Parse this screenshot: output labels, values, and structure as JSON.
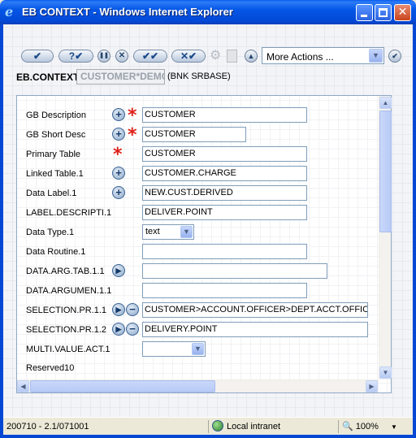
{
  "window": {
    "title": "EB CONTEXT - Windows Internet Explorer",
    "app_icon": "ie-e-icon"
  },
  "toolbar": {
    "buttons": [
      {
        "name": "commit-button",
        "glyph": "✔"
      },
      {
        "name": "validate-button",
        "glyph": "?✔"
      },
      {
        "name": "hold-button",
        "glyph": "❚❚"
      },
      {
        "name": "delete-button",
        "glyph": "✕"
      },
      {
        "name": "authorise-button",
        "glyph": "✔✔"
      },
      {
        "name": "reverse-button",
        "glyph": "✕✔"
      }
    ],
    "more_actions": "More Actions ..."
  },
  "context": {
    "label": "EB.CONTEXT",
    "record_id": "CUSTOMER*DEMO",
    "company": "(BNK SRBASE)"
  },
  "form": {
    "rows": [
      {
        "label": "GB Description",
        "value": "CUSTOMER"
      },
      {
        "label": "GB Short Desc",
        "value": "CUSTOMER"
      },
      {
        "label": "Primary Table",
        "value": "CUSTOMER"
      },
      {
        "label": "Linked Table.1",
        "value": "CUSTOMER.CHARGE"
      },
      {
        "label": "Data Label.1",
        "value": "NEW.CUST.DERIVED"
      },
      {
        "label": "LABEL.DESCRIPTI.1",
        "value": "DELIVER.POINT"
      },
      {
        "label": "Data Type.1",
        "value": "text"
      },
      {
        "label": "Data Routine.1",
        "value": ""
      },
      {
        "label": "DATA.ARG.TAB.1.1",
        "value": ""
      },
      {
        "label": "DATA.ARGUMEN.1.1",
        "value": ""
      },
      {
        "label": "SELECTION.PR.1.1",
        "value": "CUSTOMER>ACCOUNT.OFFICER>DEPT.ACCT.OFFICER>"
      },
      {
        "label": "SELECTION.PR.1.2",
        "value": "DELIVERY.POINT"
      },
      {
        "label": "MULTI.VALUE.ACT.1",
        "value": ""
      },
      {
        "label": "Reserved10",
        "value": ""
      }
    ]
  },
  "statusbar": {
    "left": "200710 - 2.1/071001",
    "zone": "Local intranet",
    "zoom": "100%"
  },
  "colors": {
    "titlebar": "#0348d5",
    "required_star": "#e0201a",
    "input_border": "#7f9db9"
  }
}
